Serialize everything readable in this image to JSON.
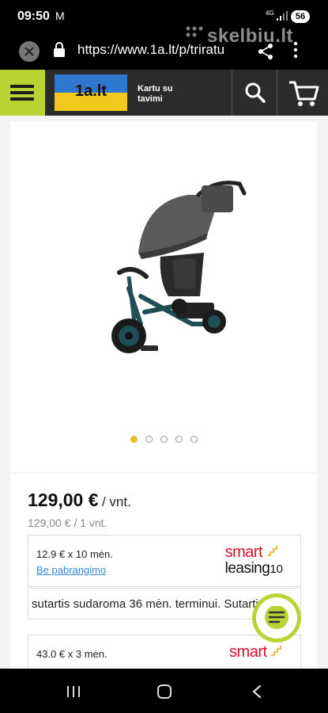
{
  "status_bar": {
    "time": "09:50",
    "network_type": "4G",
    "battery_level": "56"
  },
  "browser": {
    "url": "https://www.1a.lt/p/triratu",
    "watermark": "skelbiu.lt"
  },
  "site_header": {
    "logo_text": "1a.lt",
    "slogan": "Kartu su tavimi",
    "colors": {
      "menu_button": "#b8d432",
      "header_bg": "#2b2b2b",
      "logo_top": "#2e77d0",
      "logo_bottom": "#f2c81c"
    }
  },
  "product": {
    "image_icon": "tricycle-image",
    "carousel": {
      "total": 5,
      "active_index": 0,
      "active_color": "#f0b92d"
    },
    "price": "129,00 €",
    "price_unit": "/ vnt.",
    "price_sub": "129,00 € / 1 vnt."
  },
  "leasing": [
    {
      "amount": "12.9 € x 10 mėn.",
      "link": "Be pabrangimo",
      "brand_word": "smart",
      "brand_line": "leasing",
      "brand_number": "10"
    },
    {
      "amount": "43.0 € x 3 mėn.",
      "brand_word": "smart"
    }
  ],
  "ticker_text": "sutartis sudaroma 36 mėn. terminui. Sutartis",
  "chat_icon": "chat-lines-icon"
}
